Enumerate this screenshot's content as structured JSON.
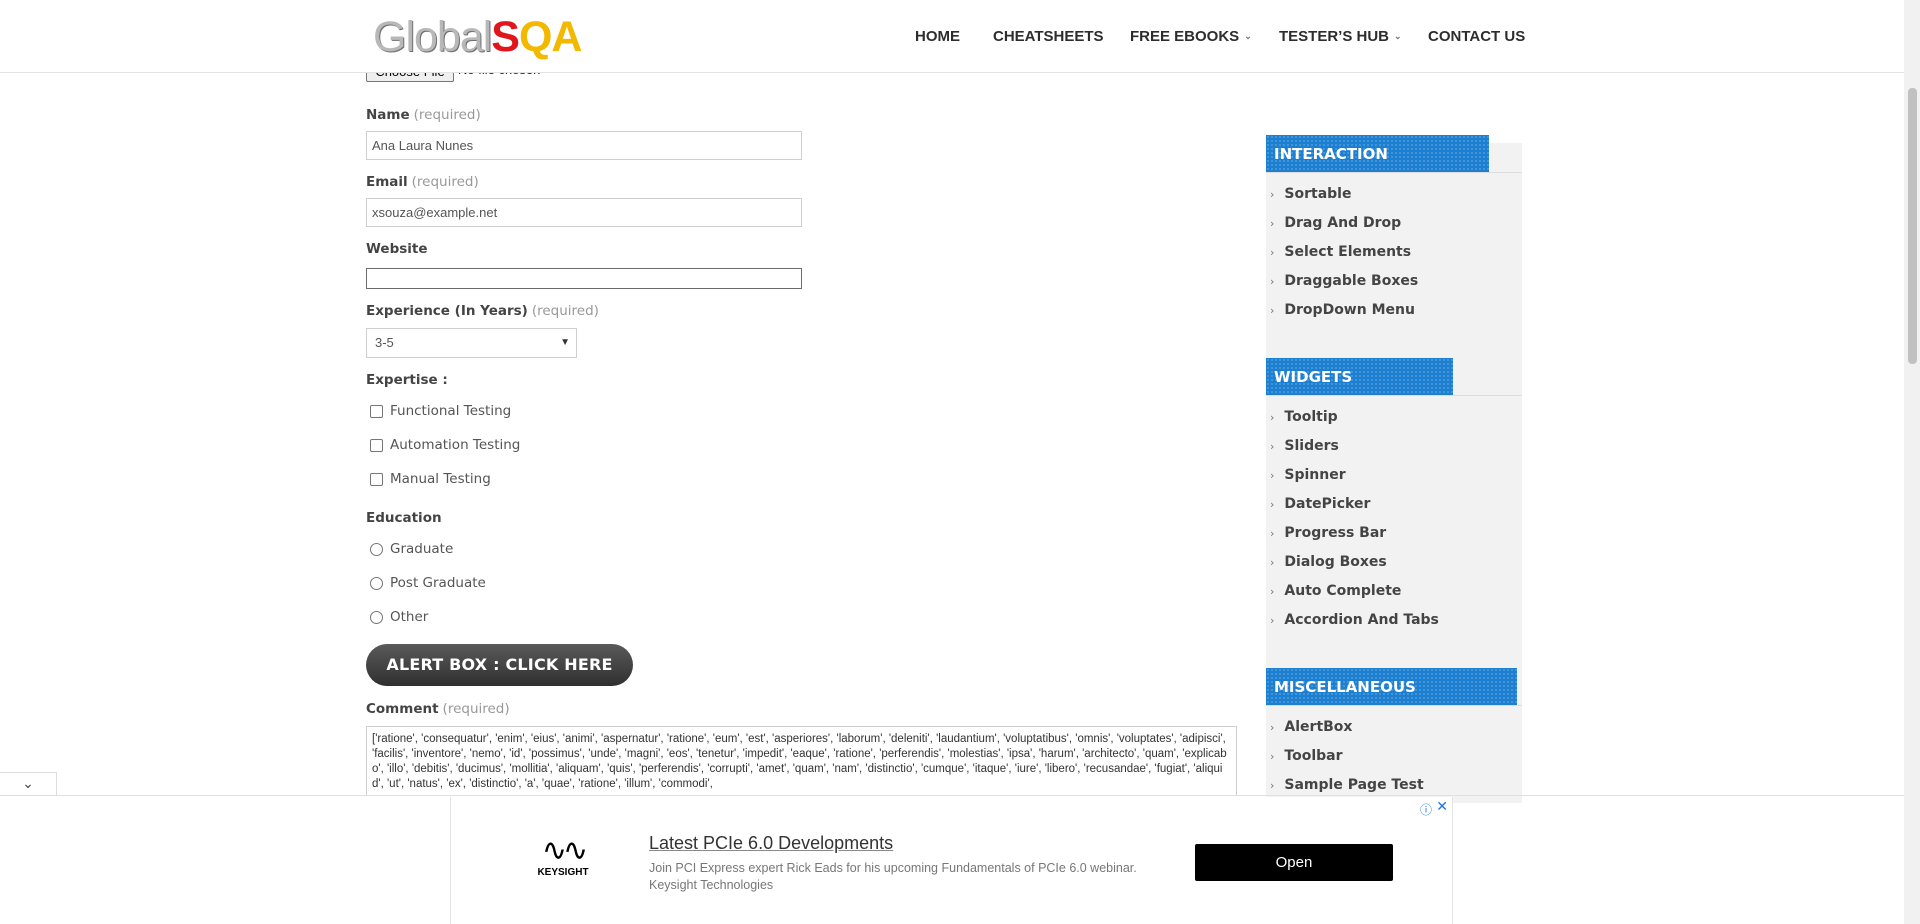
{
  "header": {
    "logo": {
      "global": "Global",
      "s": "S",
      "qa": "QA"
    },
    "nav": [
      "HOME",
      "CHEATSHEETS",
      "FREE EBOOKS",
      "TESTER’S HUB",
      "CONTACT US"
    ]
  },
  "form": {
    "file_button": "Choose File",
    "file_status": "No file chosen",
    "name_label": "Name",
    "name_req": "(required)",
    "name_value": "Ana Laura Nunes",
    "email_label": "Email",
    "email_req": "(required)",
    "email_value": "xsouza@example.net",
    "website_label": "Website",
    "website_value": "",
    "experience_label": "Experience (In Years)",
    "experience_req": "(required)",
    "experience_value": "3-5",
    "expertise_label": "Expertise :",
    "expertise_options": [
      "Functional Testing",
      "Automation Testing",
      "Manual Testing"
    ],
    "education_label": "Education",
    "education_options": [
      "Graduate",
      "Post Graduate",
      "Other"
    ],
    "alert_button": "ALERT BOX : CLICK HERE",
    "comment_label": "Comment",
    "comment_req": "(required)",
    "comment_value": "['ratione', 'consequatur', 'enim', 'eius', 'animi', 'aspernatur', 'ratione', 'eum', 'est', 'asperiores', 'laborum', 'deleniti', 'laudantium', 'voluptatibus', 'omnis', 'voluptates', 'adipisci', 'facilis', 'inventore', 'nemo', 'id', 'possimus', 'unde', 'magni', 'eos', 'tenetur', 'impedit', 'eaque', 'ratione', 'perferendis', 'molestias', 'ipsa', 'harum', 'architecto', 'quam', 'explicabo', 'illo', 'debitis', 'ducimus', 'mollitia', 'aliquam', 'quis', 'perferendis', 'corrupti', 'amet', 'quam', 'nam', 'distinctio', 'cumque', 'itaque', 'iure', 'libero', 'recusandae', 'fugiat', 'aliquid', 'ut', 'natus', 'ex', 'distinctio', 'a', 'quae', 'ratione', 'illum', 'commodi',"
  },
  "sidebar": {
    "interaction_title": "INTERACTION",
    "interaction_items": [
      "Sortable",
      "Drag And Drop",
      "Select Elements",
      "Draggable Boxes",
      "DropDown Menu"
    ],
    "widgets_title": "WIDGETS",
    "widgets_items": [
      "Tooltip",
      "Sliders",
      "Spinner",
      "DatePicker",
      "Progress Bar",
      "Dialog Boxes",
      "Auto Complete",
      "Accordion And Tabs"
    ],
    "misc_title": "MISCELLANEOUS",
    "misc_items": [
      "AlertBox",
      "Toolbar",
      "Sample Page Test"
    ]
  },
  "ad": {
    "brand": "KEYSIGHT",
    "title": "Latest PCIe 6.0 Developments",
    "description": "Join PCI Express expert Rick Eads for his upcoming Fundamentals of PCIe 6.0 webinar. Keysight Technologies",
    "cta": "Open"
  },
  "colors": {
    "accent_blue": "#1d7fd0",
    "logo_red": "#e1161c",
    "logo_yellow": "#f3b800"
  }
}
